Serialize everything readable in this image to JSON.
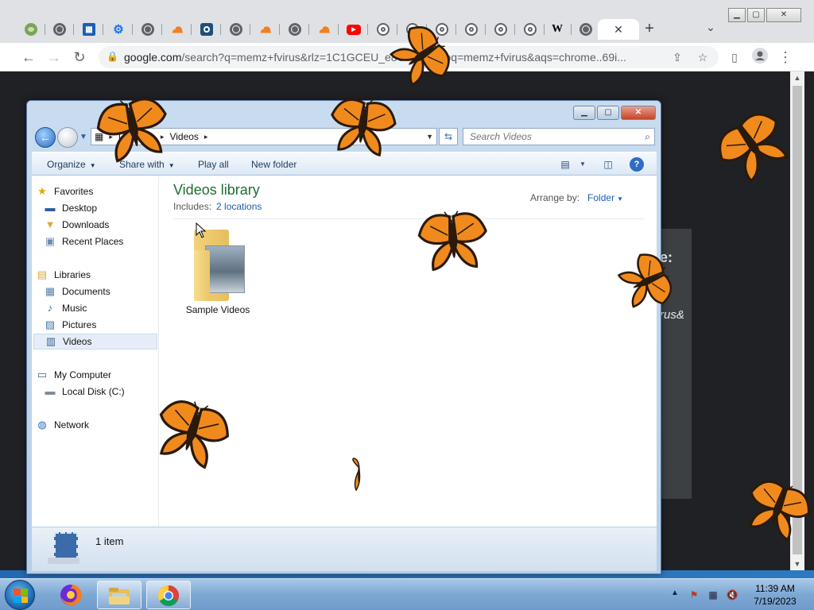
{
  "chrome": {
    "tabs": [
      {
        "icon": "turtle-icon",
        "color": "#7aa35a"
      },
      {
        "icon": "globe-icon",
        "color": "#5f6368"
      },
      {
        "icon": "blue-square-icon",
        "color": "#1a5fb4"
      },
      {
        "icon": "gear-icon",
        "color": "#1a73e8"
      },
      {
        "icon": "globe-icon",
        "color": "#5f6368"
      },
      {
        "icon": "cloudflare-icon",
        "color": "#f38020"
      },
      {
        "icon": "qualys-icon",
        "color": "#1f4e79"
      },
      {
        "icon": "globe-icon",
        "color": "#5f6368"
      },
      {
        "icon": "cloudflare-icon",
        "color": "#f38020"
      },
      {
        "icon": "globe-icon",
        "color": "#5f6368"
      },
      {
        "icon": "cloudflare-icon",
        "color": "#f38020"
      },
      {
        "icon": "youtube-icon",
        "color": "#ff0000"
      },
      {
        "icon": "chrome-icon",
        "color": "#5f6368"
      },
      {
        "icon": "chrome-icon",
        "color": "#5f6368"
      },
      {
        "icon": "chrome-icon",
        "color": "#5f6368"
      },
      {
        "icon": "chrome-icon",
        "color": "#5f6368"
      },
      {
        "icon": "chrome-icon",
        "color": "#5f6368"
      },
      {
        "icon": "chrome-icon",
        "color": "#5f6368"
      },
      {
        "icon": "wikipedia-icon",
        "color": "#000000"
      },
      {
        "icon": "globe-icon",
        "color": "#5f6368"
      }
    ],
    "wiki_letter": "W",
    "new_tab": "+",
    "url_host": "google.com",
    "url_path": "/search?q=memz+fvirus&rlz=1C1GCEU_e",
    "url_path_tail": "8US1058&oq=memz+fvirus&aqs=chrome..69i...",
    "page_fragment_1": "e:",
    "page_fragment_2": "rus&"
  },
  "explorer": {
    "breadcrumb": [
      "Libraries",
      "Videos"
    ],
    "search_placeholder": "Search Videos",
    "toolbar": {
      "organize": "Organize",
      "share_with": "Share with",
      "play_all": "Play all",
      "new_folder": "New folder"
    },
    "nav": {
      "favorites": "Favorites",
      "desktop": "Desktop",
      "downloads": "Downloads",
      "recent_places": "Recent Places",
      "libraries": "Libraries",
      "documents": "Documents",
      "music": "Music",
      "pictures": "Pictures",
      "videos": "Videos",
      "my_computer": "My Computer",
      "local_disk": "Local Disk (C:)",
      "network": "Network"
    },
    "library_title": "Videos library",
    "includes_label": "Includes:",
    "includes_link": "2 locations",
    "arrange_label": "Arrange by:",
    "arrange_value": "Folder",
    "folder_name": "Sample Videos",
    "status": "1 item"
  },
  "taskbar": {
    "time": "11:39 AM",
    "date": "7/19/2023"
  },
  "colors": {
    "butterfly_orange": "#f08a1c",
    "butterfly_dark": "#2a1a0c",
    "library_green": "#1e6e2e",
    "link_blue": "#1a5fb4"
  }
}
